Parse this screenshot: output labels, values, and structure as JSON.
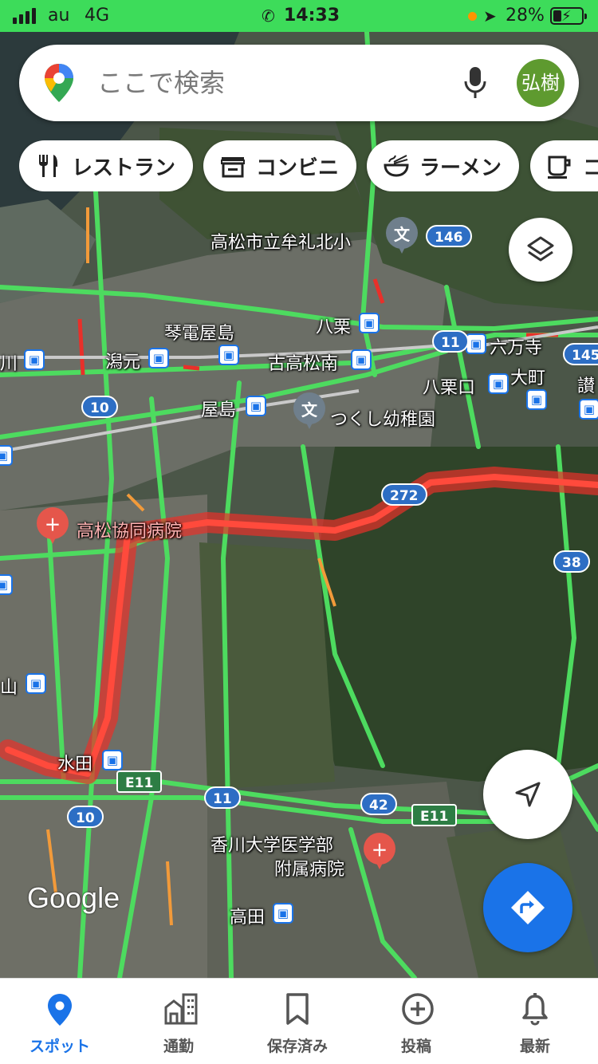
{
  "status_bar": {
    "carrier": "au",
    "network": "4G",
    "time": "14:33",
    "battery_percent": "28%",
    "battery_level": 0.28
  },
  "search": {
    "placeholder": "ここで検索",
    "avatar_text": "弘樹"
  },
  "chips": [
    {
      "label": "レストラン",
      "icon": "fork-knife-icon"
    },
    {
      "label": "コンビニ",
      "icon": "store-icon"
    },
    {
      "label": "ラーメン",
      "icon": "ramen-bowl-icon"
    },
    {
      "label": "コ",
      "icon": "coffee-cup-icon"
    }
  ],
  "map": {
    "places": {
      "school": "高松市立牟礼北小",
      "kindergarten": "つくし幼稚園",
      "hospital1": "高松協同病院",
      "hospital2_line1": "香川大学医学部",
      "hospital2_line2": "附属病院"
    },
    "stations": {
      "kotoden_yashima": "琴電屋島",
      "katamoto": "潟元",
      "furutakamatsu_minami": "古高松南",
      "yakuri": "八栗",
      "yakuriguchi": "八栗口",
      "rokumanji": "六万寺",
      "omachi": "大町",
      "yashima": "屋島",
      "mizuta": "水田",
      "takada": "高田",
      "left_kawa": "川",
      "left_yama": "山",
      "right_sanu": "讃"
    },
    "route_shields": [
      "146",
      "11",
      "145",
      "10",
      "272",
      "38",
      "E11",
      "11",
      "42",
      "E11",
      "10"
    ],
    "attribution": "Google"
  },
  "nav": [
    {
      "label": "スポット",
      "icon": "explore-pin-icon",
      "active": true
    },
    {
      "label": "通勤",
      "icon": "commute-icon",
      "active": false
    },
    {
      "label": "保存済み",
      "icon": "bookmark-icon",
      "active": false
    },
    {
      "label": "投稿",
      "icon": "contribute-plus-icon",
      "active": false
    },
    {
      "label": "最新",
      "icon": "bell-icon",
      "active": false
    }
  ],
  "colors": {
    "status_bar": "#3ddc5a",
    "accent": "#1a73e8",
    "traffic_heavy": "#e8302a",
    "traffic_free": "#4ddb5f",
    "avatar": "#5e9a2f"
  }
}
